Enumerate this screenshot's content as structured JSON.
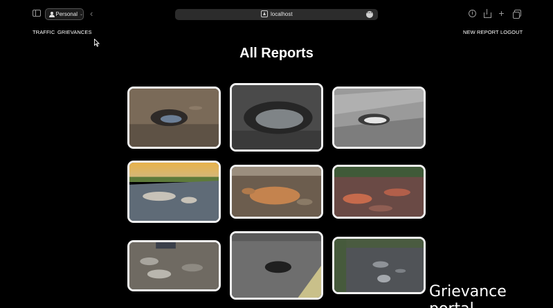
{
  "browser": {
    "profile_label": "Personal",
    "url": "localhost"
  },
  "nav": {
    "left": [
      "TRAFFIC",
      "GRIEVANCES"
    ],
    "right": [
      "NEW REPORT",
      "LOGOUT"
    ]
  },
  "page": {
    "title": "All Reports"
  },
  "reports": [
    {
      "image": "pothole-photo-1"
    },
    {
      "image": "pothole-photo-2"
    },
    {
      "image": "pothole-photo-3"
    },
    {
      "image": "pothole-photo-4"
    },
    {
      "image": "pothole-photo-5"
    },
    {
      "image": "pothole-photo-6"
    },
    {
      "image": "pothole-photo-7"
    },
    {
      "image": "pothole-photo-8"
    },
    {
      "image": "pothole-photo-9"
    }
  ],
  "caption": "Grievance portal",
  "colors": {
    "background": "#000000",
    "card_border": "#f2f2f2",
    "urlbar": "#2c2c2c"
  }
}
